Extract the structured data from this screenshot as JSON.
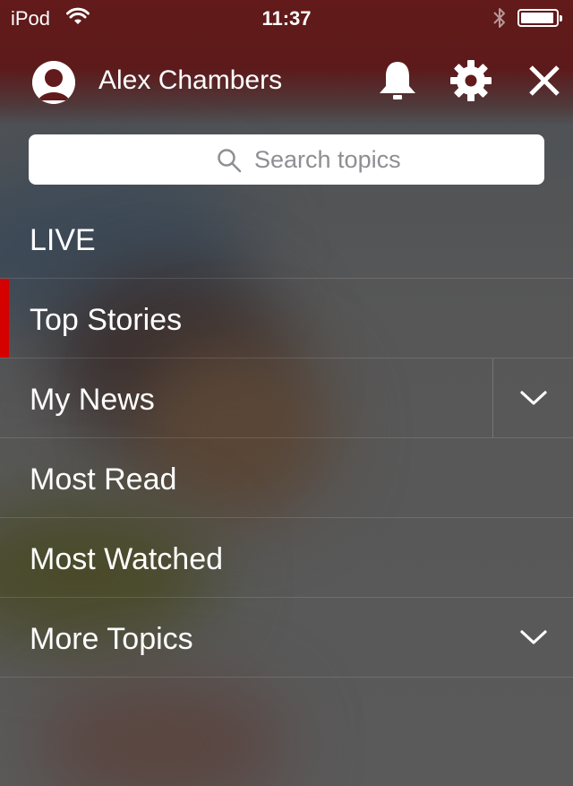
{
  "status_bar": {
    "carrier": "iPod",
    "time": "11:37",
    "battery_level": 0.95
  },
  "profile": {
    "user_name": "Alex Chambers"
  },
  "search": {
    "placeholder": "Search topics"
  },
  "menu": {
    "items": [
      {
        "label": "LIVE",
        "active": false,
        "expandable": false
      },
      {
        "label": "Top Stories",
        "active": true,
        "expandable": false
      },
      {
        "label": "My News",
        "active": false,
        "expandable": true
      },
      {
        "label": "Most Read",
        "active": false,
        "expandable": false
      },
      {
        "label": "Most Watched",
        "active": false,
        "expandable": false
      },
      {
        "label": "More Topics",
        "active": false,
        "expandable": true
      }
    ]
  },
  "colors": {
    "header": "#621a1a",
    "accent": "#d50000",
    "text": "#ffffff"
  },
  "icons": [
    "wifi-icon",
    "bluetooth-icon",
    "battery-icon",
    "avatar-icon",
    "bell-icon",
    "gear-icon",
    "close-icon",
    "search-icon",
    "chevron-down-icon"
  ]
}
